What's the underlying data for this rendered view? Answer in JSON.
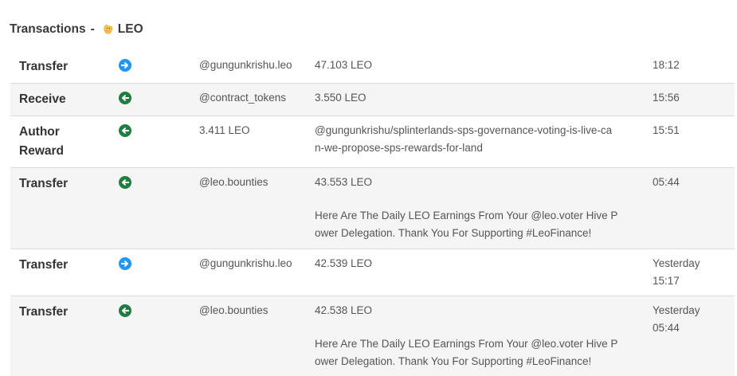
{
  "header": {
    "title": "Transactions",
    "separator": "-",
    "token": "LEO",
    "token_icon": "leo-lion-icon"
  },
  "colors": {
    "send": "#2196f3",
    "receive": "#1e7d3f",
    "divider": "#dcdcdc",
    "stripe": "#f5f5f5"
  },
  "transactions": [
    {
      "type": "Transfer",
      "direction": "send",
      "icon": "arrow-right-circle-icon",
      "party": "@gungunkrishu.leo",
      "amount": "47.103 LEO",
      "memo": "",
      "time": "18:12"
    },
    {
      "type": "Receive",
      "direction": "receive",
      "icon": "arrow-left-circle-icon",
      "party": "@contract_tokens",
      "amount": "3.550 LEO",
      "memo": "",
      "time": "15:56"
    },
    {
      "type_line1": "Author",
      "type_line2": "Reward",
      "direction": "receive",
      "icon": "arrow-left-circle-icon",
      "party": "3.411 LEO",
      "memo_line1": "@gungunkrishu/splinterlands-sps-governance-voting-is-live-ca",
      "memo_line2": "n-we-propose-sps-rewards-for-land",
      "time": "15:51"
    },
    {
      "type": "Transfer",
      "direction": "receive",
      "icon": "arrow-left-circle-icon",
      "party": "@leo.bounties",
      "amount": "43.553 LEO",
      "memo_line1": "Here Are The Daily LEO Earnings From Your @leo.voter Hive P",
      "memo_line2": "ower Delegation. Thank You For Supporting #LeoFinance!",
      "time": "05:44"
    },
    {
      "type": "Transfer",
      "direction": "send",
      "icon": "arrow-right-circle-icon",
      "party": "@gungunkrishu.leo",
      "amount": "42.539 LEO",
      "memo": "",
      "time_line1": "Yesterday",
      "time_line2": "15:17"
    },
    {
      "type": "Transfer",
      "direction": "receive",
      "icon": "arrow-left-circle-icon",
      "party": "@leo.bounties",
      "amount": "42.538 LEO",
      "memo_line1": "Here Are The Daily LEO Earnings From Your @leo.voter Hive P",
      "memo_line2": "ower Delegation. Thank You For Supporting #LeoFinance!",
      "time_line1": "Yesterday",
      "time_line2": "05:44"
    }
  ]
}
